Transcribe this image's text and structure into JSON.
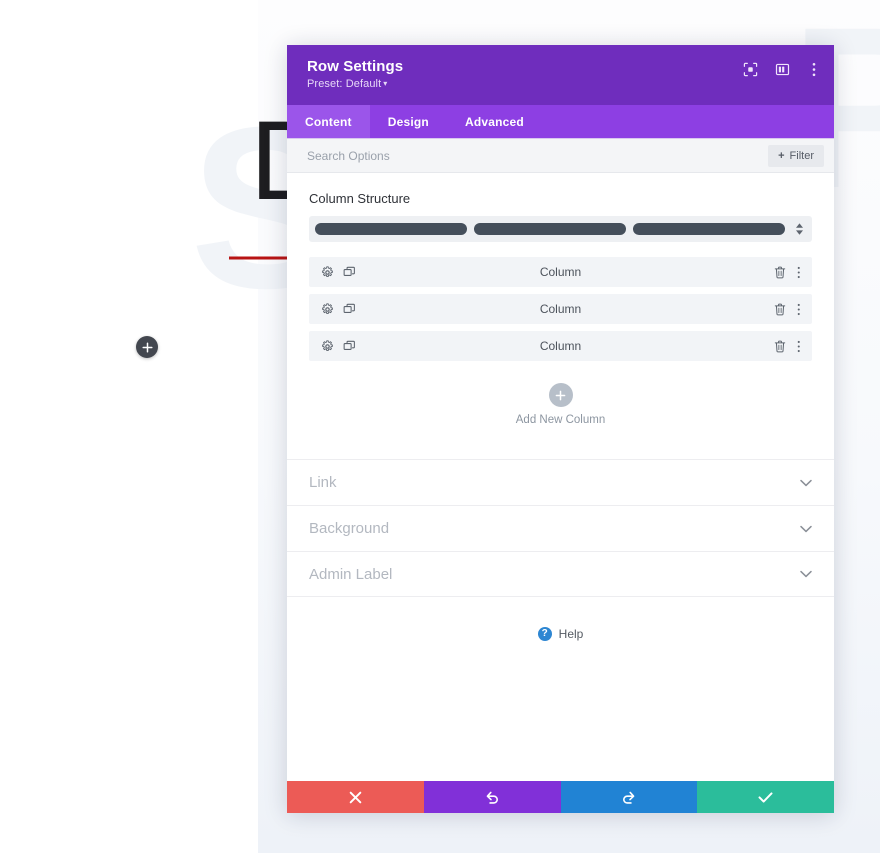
{
  "background": {
    "headline": "Design",
    "watermark_left": "S",
    "watermark_right": "P",
    "add_module_label": "+"
  },
  "annotation": {
    "type": "arrow",
    "color": "#b81414",
    "points_to": "first-column-row"
  },
  "modal": {
    "title": "Row Settings",
    "preset": "Preset: Default",
    "preset_caret": "▾",
    "header_icons": [
      {
        "name": "expand-icon",
        "label": "Expand"
      },
      {
        "name": "layout-panel-icon",
        "label": "Change Layout"
      },
      {
        "name": "kebab-menu-icon",
        "label": "More Options"
      }
    ],
    "tabs": [
      {
        "label": "Content",
        "active": true
      },
      {
        "label": "Design",
        "active": false
      },
      {
        "label": "Advanced",
        "active": false
      }
    ],
    "search": {
      "placeholder": "Search Options",
      "value": ""
    },
    "filter": {
      "label": "Filter",
      "plus": "+"
    },
    "content": {
      "section_label": "Column Structure",
      "structure_bars": 3,
      "columns": [
        {
          "label": "Column"
        },
        {
          "label": "Column"
        },
        {
          "label": "Column"
        }
      ],
      "add_new_column": "Add New Column",
      "add_new_column_plus": "+",
      "accordions": [
        {
          "label": "Link",
          "expanded": false
        },
        {
          "label": "Background",
          "expanded": false
        },
        {
          "label": "Admin Label",
          "expanded": false
        }
      ],
      "help": "Help",
      "help_glyph": "?"
    },
    "footer_buttons": [
      {
        "name": "discard-button",
        "icon": "close-icon",
        "color": "#ec5b56"
      },
      {
        "name": "undo-button",
        "icon": "undo-icon",
        "color": "#8130d8"
      },
      {
        "name": "redo-button",
        "icon": "redo-icon",
        "color": "#2183d4"
      },
      {
        "name": "save-button",
        "icon": "checkmark-icon",
        "color": "#2bbd9b"
      }
    ]
  },
  "colors": {
    "header_purple": "#6f2dbd",
    "tabs_purple": "#8d3fe3",
    "active_tab_purple": "#9b55ea",
    "structure_bar": "#454f5b",
    "row_bg": "#f2f4f7"
  }
}
